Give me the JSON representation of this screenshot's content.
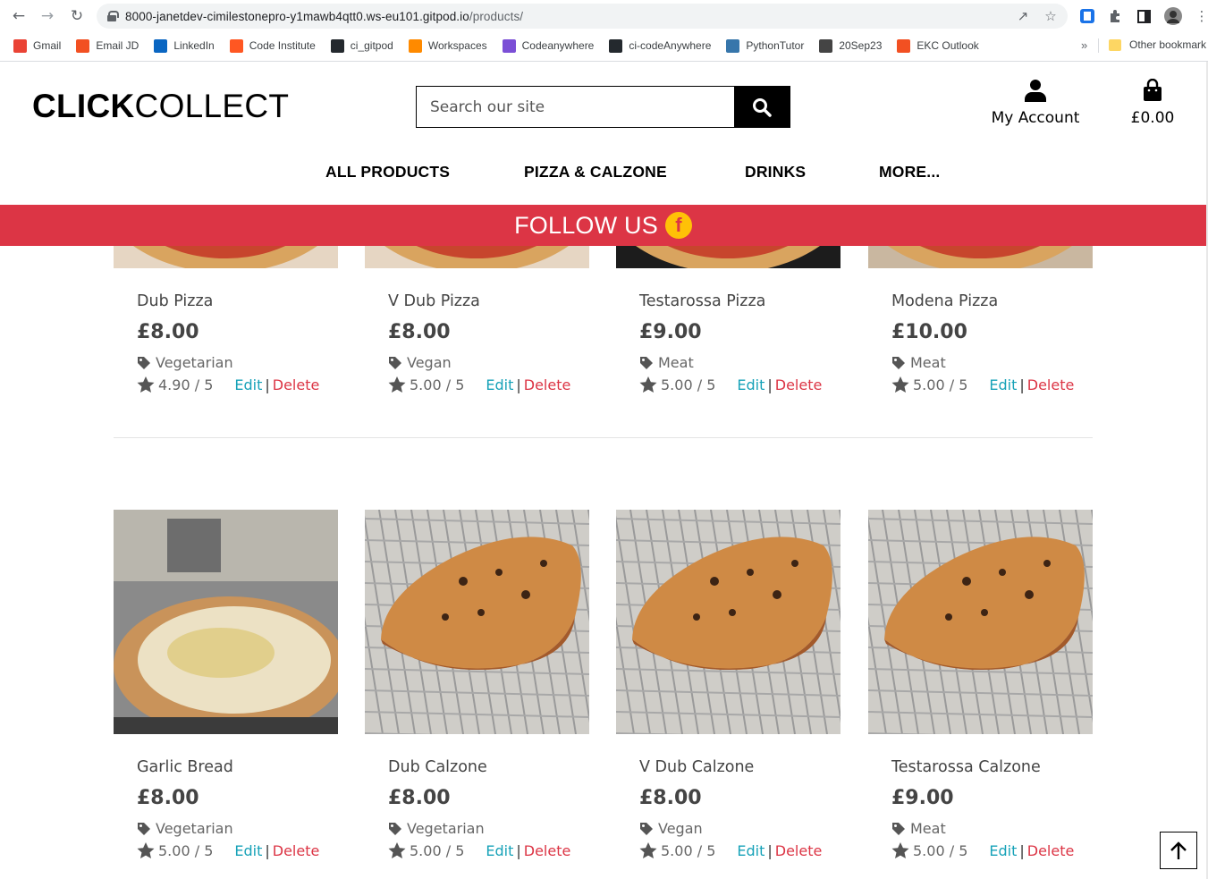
{
  "browser": {
    "url_host": "8000-janetdev-cimilestonepro-y1mawb4qtt0.ws-eu101.gitpod.io",
    "url_path": "/products/",
    "bookmarks": [
      {
        "label": "Gmail",
        "color": "#ea4335"
      },
      {
        "label": "Email JD",
        "color": "#f25022"
      },
      {
        "label": "LinkedIn",
        "color": "#0a66c2"
      },
      {
        "label": "Code Institute",
        "color": "#ff5722"
      },
      {
        "label": "ci_gitpod",
        "color": "#24292e"
      },
      {
        "label": "Workspaces",
        "color": "#ff8a00"
      },
      {
        "label": "Codeanywhere",
        "color": "#7b4fd6"
      },
      {
        "label": "ci-codeAnywhere",
        "color": "#24292e"
      },
      {
        "label": "PythonTutor",
        "color": "#3776ab"
      },
      {
        "label": "20Sep23",
        "color": "#444444"
      },
      {
        "label": "EKC Outlook",
        "color": "#f25022"
      }
    ],
    "overflow": "»",
    "other_bookmarks": "Other bookmark"
  },
  "header": {
    "logo_bold": "CLICK",
    "logo_light": "COLLECT",
    "search_placeholder": "Search our site",
    "account_label": "My Account",
    "bag_total": "£0.00"
  },
  "nav": {
    "items": [
      "ALL PRODUCTS",
      "PIZZA & CALZONE",
      "DRINKS",
      "MORE..."
    ]
  },
  "banner": {
    "text": "FOLLOW US",
    "accent": "#dc3545"
  },
  "products": [
    {
      "name": "Dub Pizza",
      "price": "£8.00",
      "category": "Vegetarian",
      "rating": "4.90 / 5",
      "edit": "Edit",
      "sep": "|",
      "delete": "Delete",
      "image": "pizza"
    },
    {
      "name": "V Dub Pizza",
      "price": "£8.00",
      "category": "Vegan",
      "rating": "5.00 / 5",
      "edit": "Edit",
      "sep": "|",
      "delete": "Delete",
      "image": "pizza"
    },
    {
      "name": "Testarossa Pizza",
      "price": "£9.00",
      "category": "Meat",
      "rating": "5.00 / 5",
      "edit": "Edit",
      "sep": "|",
      "delete": "Delete",
      "image": "pizza-dark"
    },
    {
      "name": "Modena Pizza",
      "price": "£10.00",
      "category": "Meat",
      "rating": "5.00 / 5",
      "edit": "Edit",
      "sep": "|",
      "delete": "Delete",
      "image": "pizza-box"
    },
    {
      "name": "Garlic Bread",
      "price": "£8.00",
      "category": "Vegetarian",
      "rating": "5.00 / 5",
      "edit": "Edit",
      "sep": "|",
      "delete": "Delete",
      "image": "garlic-bread"
    },
    {
      "name": "Dub Calzone",
      "price": "£8.00",
      "category": "Vegetarian",
      "rating": "5.00 / 5",
      "edit": "Edit",
      "sep": "|",
      "delete": "Delete",
      "image": "calzone"
    },
    {
      "name": "V Dub Calzone",
      "price": "£8.00",
      "category": "Vegan",
      "rating": "5.00 / 5",
      "edit": "Edit",
      "sep": "|",
      "delete": "Delete",
      "image": "calzone"
    },
    {
      "name": "Testarossa Calzone",
      "price": "£9.00",
      "category": "Meat",
      "rating": "5.00 / 5",
      "edit": "Edit",
      "sep": "|",
      "delete": "Delete",
      "image": "calzone"
    }
  ],
  "back_to_top_icon": "arrow-up-icon"
}
